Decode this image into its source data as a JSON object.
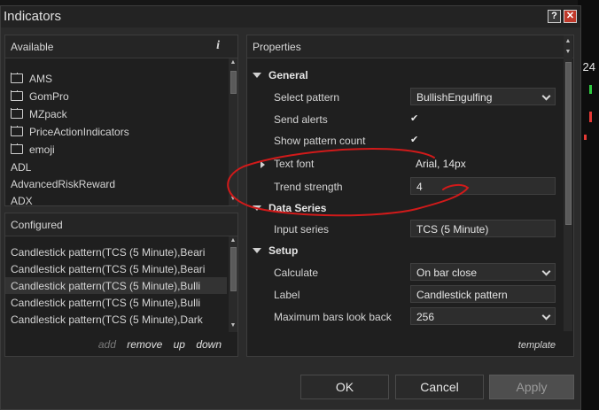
{
  "window": {
    "title": "Indicators",
    "help_label": "?",
    "close_label": "✕"
  },
  "background": {
    "price_label": "24"
  },
  "available": {
    "header": "Available",
    "info_label": "i",
    "folders": [
      "AMS",
      "GomPro",
      "MZpack",
      "PriceActionIndicators",
      "emoji"
    ],
    "items": [
      "ADL",
      "AdvancedRiskReward",
      "ADX"
    ]
  },
  "configured": {
    "header": "Configured",
    "rows": [
      "Candlestick pattern(TCS (5 Minute),Beari",
      "Candlestick pattern(TCS (5 Minute),Beari",
      "Candlestick pattern(TCS (5 Minute),Bulli",
      "Candlestick pattern(TCS (5 Minute),Bulli",
      "Candlestick pattern(TCS (5 Minute),Dark"
    ],
    "selected_index": 2,
    "actions": {
      "add": "add",
      "remove": "remove",
      "up": "up",
      "down": "down"
    }
  },
  "properties": {
    "header": "Properties",
    "sections": {
      "general": "General",
      "data_series": "Data Series",
      "setup": "Setup"
    },
    "fields": {
      "select_pattern": {
        "label": "Select pattern",
        "value": "BullishEngulfing"
      },
      "send_alerts": {
        "label": "Send alerts",
        "checked": true
      },
      "show_pattern_count": {
        "label": "Show pattern count",
        "checked": true
      },
      "text_font": {
        "label": "Text font",
        "value": "Arial, 14px"
      },
      "trend_strength": {
        "label": "Trend strength",
        "value": "4"
      },
      "input_series": {
        "label": "Input series",
        "value": "TCS (5 Minute)"
      },
      "calculate": {
        "label": "Calculate",
        "value": "On bar close"
      },
      "label": {
        "label": "Label",
        "value": "Candlestick pattern"
      },
      "max_bars": {
        "label": "Maximum bars look back",
        "value": "256"
      }
    },
    "template_link": "template"
  },
  "buttons": {
    "ok": "OK",
    "cancel": "Cancel",
    "apply": "Apply"
  },
  "colors": {
    "annotation": "#d11a1a",
    "close": "#c0392b"
  }
}
